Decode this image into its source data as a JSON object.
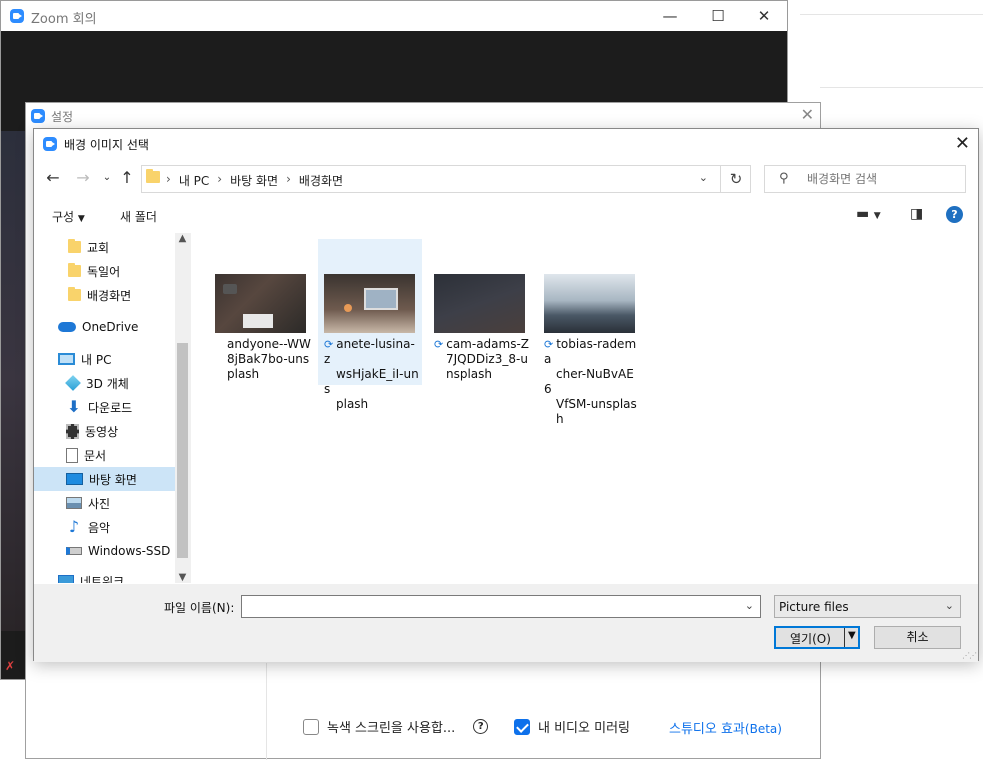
{
  "zoom_window": {
    "title": "Zoom 회의",
    "minimize": "—",
    "maximize": "☐",
    "close": "✕"
  },
  "settings_window": {
    "title": "설정",
    "close": "✕",
    "green_screen_label": "녹색 스크린을 사용합...",
    "mirror_label": "내 비디오 미러링",
    "studio_effects": "스튜디오 효과",
    "studio_beta": "(Beta)"
  },
  "dialog": {
    "title": "배경 이미지 선택",
    "close": "✕",
    "breadcrumbs": [
      "내 PC",
      "바탕 화면",
      "배경화면"
    ],
    "search_placeholder": "배경화면 검색",
    "toolbar": {
      "organize": "구성",
      "new_folder": "새 폴더"
    },
    "nav_items": [
      {
        "label": "교회",
        "icon": "folder-icon"
      },
      {
        "label": "독일어",
        "icon": "folder-icon"
      },
      {
        "label": "배경화면",
        "icon": "folder-icon"
      },
      {
        "label": "OneDrive",
        "icon": "onedrive-icon"
      },
      {
        "label": "내 PC",
        "icon": "pc-icon"
      },
      {
        "label": "3D 개체",
        "icon": "3d-objects-icon"
      },
      {
        "label": "다운로드",
        "icon": "download-icon"
      },
      {
        "label": "동영상",
        "icon": "video-icon"
      },
      {
        "label": "문서",
        "icon": "document-icon"
      },
      {
        "label": "바탕 화면",
        "icon": "desktop-icon"
      },
      {
        "label": "사진",
        "icon": "pictures-icon"
      },
      {
        "label": "음악",
        "icon": "music-icon"
      },
      {
        "label": "Windows-SSD (",
        "icon": "drive-icon"
      },
      {
        "label": "네트워크",
        "icon": "network-icon"
      }
    ],
    "files": [
      {
        "lines": [
          "andyone--WW",
          "8jBak7bo-uns",
          "plash"
        ],
        "synced": false
      },
      {
        "lines": [
          "anete-lusina-z",
          "wsHjakE_iI-uns",
          "plash"
        ],
        "synced": true
      },
      {
        "lines": [
          "cam-adams-Z",
          "7JQDDiz3_8-u",
          "nsplash"
        ],
        "synced": true
      },
      {
        "lines": [
          "tobias-radema",
          "cher-NuBvAE6",
          "VfSM-unsplas",
          "h"
        ],
        "synced": true
      }
    ],
    "filename_label": "파일 이름(N):",
    "filename_value": "",
    "filter_value": "Picture files",
    "open_label": "열기(O)",
    "cancel_label": "취소"
  },
  "colors": {
    "accent": "#0078d7",
    "zoom_blue": "#2d8cff",
    "selection": "#cce4f7"
  }
}
